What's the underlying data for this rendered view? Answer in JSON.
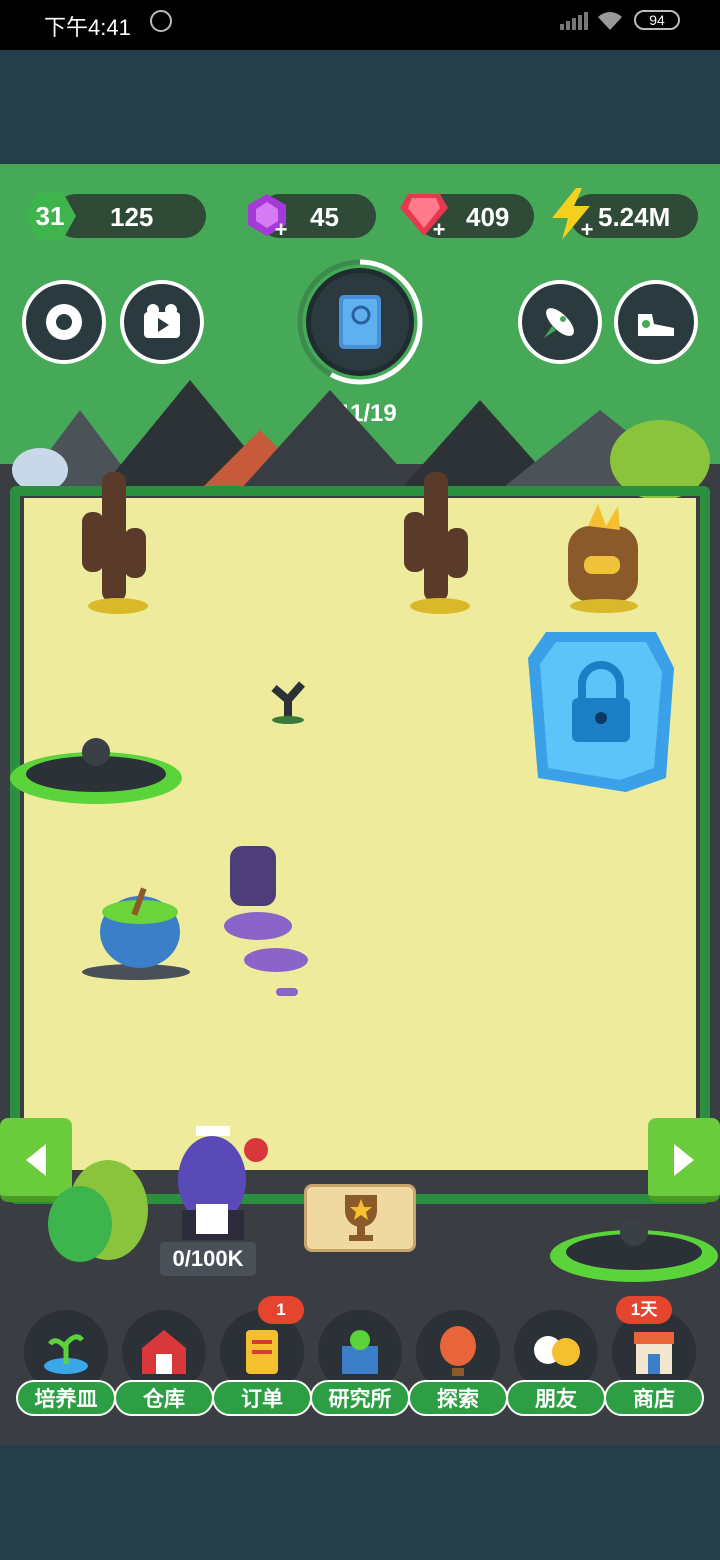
{
  "status_bar": {
    "time": "下午4:41",
    "battery": "94"
  },
  "resources": {
    "level": "31",
    "level_value": "125",
    "purple_gems": "45",
    "red_gems": "409",
    "energy": "5.24M"
  },
  "collection": {
    "progress_text": "11/19",
    "progress_fraction": 0.58
  },
  "character": {
    "capacity_text": "0/100K"
  },
  "nav": {
    "items": [
      {
        "label": "培养皿",
        "icon": "petri-dish-icon"
      },
      {
        "label": "仓库",
        "icon": "barn-icon"
      },
      {
        "label": "订单",
        "icon": "scroll-icon",
        "badge": "1"
      },
      {
        "label": "研究所",
        "icon": "lab-icon"
      },
      {
        "label": "探索",
        "icon": "balloon-icon"
      },
      {
        "label": "朋友",
        "icon": "friends-icon"
      },
      {
        "label": "商店",
        "icon": "shop-icon",
        "badge": "1天"
      }
    ]
  },
  "colors": {
    "green_bg": "#45a957",
    "field": "#eeeb9c",
    "frame": "#3a3d42",
    "nav_label": "#2e9e44",
    "badge": "#e5452f"
  }
}
